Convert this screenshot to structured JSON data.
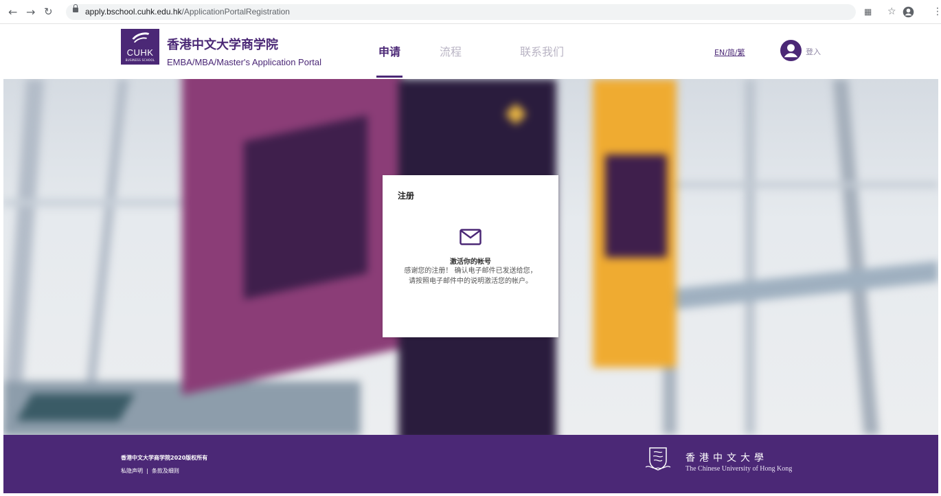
{
  "browser": {
    "url_host": "apply.bschool.cuhk.edu.hk",
    "url_path": "/ApplicationPortalRegistration"
  },
  "header": {
    "logo_text": "CUHK",
    "logo_subtext": "BUSINESS SCHOOL",
    "brand_zh": "香港中文大学商学院",
    "brand_en": "EMBA/MBA/Master's Application Portal",
    "nav": [
      {
        "label": "申请",
        "active": true
      },
      {
        "label": "流程",
        "active": false
      },
      {
        "label": "联系我们",
        "active": false
      }
    ],
    "lang_links": [
      "EN",
      "简",
      "繁"
    ],
    "login_label": "登入"
  },
  "card": {
    "title": "注册",
    "icon": "mail-icon",
    "heading": "激活你的帐号",
    "message": "感谢您的注册！ 确认电子邮件已发送给您，请按照电子邮件中的说明激活您的帐户。"
  },
  "footer": {
    "copyright": "香港中文大学商学院2020版权所有",
    "privacy": "私隐声明",
    "terms": "条款及细则",
    "separator": "|",
    "university_zh": "香港中文大學",
    "university_en": "The Chinese University of Hong Kong"
  },
  "colors": {
    "brand_purple": "#4b2876",
    "nav_inactive": "#b9b4c4"
  }
}
